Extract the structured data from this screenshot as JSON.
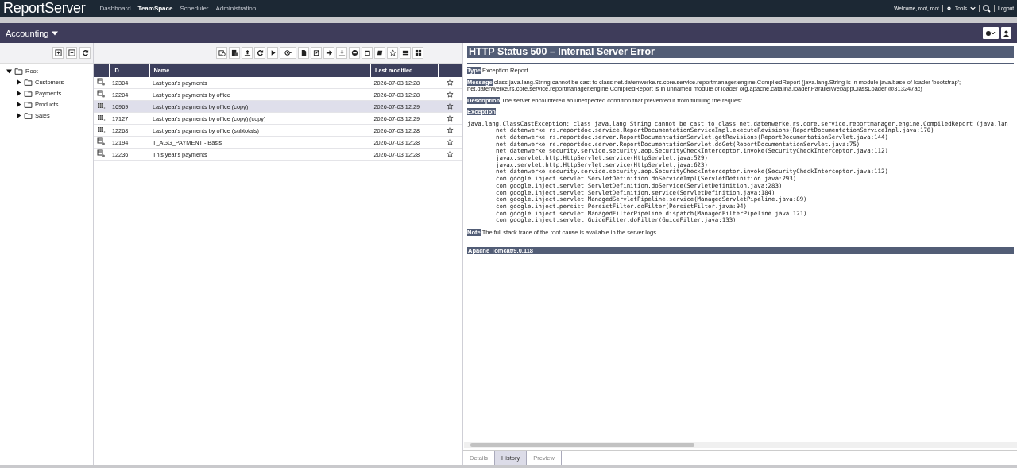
{
  "header": {
    "logo": "ReportServer",
    "nav": [
      {
        "label": "Dashboard",
        "selected": false
      },
      {
        "label": "TeamSpace",
        "selected": true
      },
      {
        "label": "Scheduler",
        "selected": false
      },
      {
        "label": "Administration",
        "selected": false
      }
    ],
    "welcome": "Welcome, root, root",
    "tools": "Tools",
    "logout": "Logout"
  },
  "teamspace": {
    "title": "Accounting"
  },
  "tree": [
    {
      "label": "Root",
      "expanded": true,
      "children": [
        {
          "label": "Customers",
          "expanded": false
        },
        {
          "label": "Payments",
          "expanded": false
        },
        {
          "label": "Products",
          "expanded": false
        },
        {
          "label": "Sales",
          "expanded": false
        }
      ]
    }
  ],
  "table": {
    "columns": [
      "ID",
      "Name",
      "Last modified"
    ],
    "rows": [
      {
        "kind": "report",
        "id": "12304",
        "name": "Last year's payments",
        "modified": "2026-07-03 12:28",
        "selected": false,
        "starred": false
      },
      {
        "kind": "report",
        "id": "12204",
        "name": "Last year's payments by office",
        "modified": "2026-07-03 12:28",
        "selected": false,
        "starred": false
      },
      {
        "kind": "grid",
        "id": "16969",
        "name": "Last year's payments by office (copy)",
        "modified": "2026-07-03 12:29",
        "selected": true,
        "starred": false
      },
      {
        "kind": "grid",
        "id": "17127",
        "name": "Last year's payments by office (copy) (copy)",
        "modified": "2026-07-03 12:29",
        "selected": false,
        "starred": false
      },
      {
        "kind": "grid",
        "id": "12268",
        "name": "Last year's payments by office (subtotals)",
        "modified": "2026-07-03 12:28",
        "selected": false,
        "starred": false
      },
      {
        "kind": "report",
        "id": "12194",
        "name": "T_AGG_PAYMENT - Basis",
        "modified": "2026-07-03 12:28",
        "selected": false,
        "starred": false
      },
      {
        "kind": "report",
        "id": "12236",
        "name": "This year's payments",
        "modified": "2026-07-03 12:28",
        "selected": false,
        "starred": false
      }
    ]
  },
  "error": {
    "title": "HTTP Status 500 – Internal Server Error",
    "fields": [
      {
        "label": "Type",
        "text": "Exception Report"
      },
      {
        "label": "Message",
        "text": "class java.lang.String cannot be cast to class net.datenwerke.rs.core.service.reportmanager.engine.CompiledReport (java.lang.String is in module java.base of loader 'bootstrap'; net.datenwerke.rs.core.service.reportmanager.engine.CompiledReport is in unnamed module of loader org.apache.catalina.loader.ParallelWebappClassLoader @313247ac)"
      },
      {
        "label": "Description",
        "text": "The server encountered an unexpected condition that prevented it from fulfilling the request."
      },
      {
        "label": "Exception"
      }
    ],
    "exception": "java.lang.ClassCastException: class java.lang.String cannot be cast to class net.datenwerke.rs.core.service.reportmanager.engine.CompiledReport (java.lan",
    "frames": [
      "net.datenwerke.rs.reportdoc.service.ReportDocumentationServiceImpl.executeRevisions(ReportDocumentationServiceImpl.java:170)",
      "net.datenwerke.rs.reportdoc.server.ReportDocumentationServlet.getRevisions(ReportDocumentationServlet.java:144)",
      "net.datenwerke.rs.reportdoc.server.ReportDocumentationServlet.doGet(ReportDocumentationServlet.java:75)",
      "net.datenwerke.security.service.security.aop.SecurityCheckInterceptor.invoke(SecurityCheckInterceptor.java:112)",
      "javax.servlet.http.HttpServlet.service(HttpServlet.java:529)",
      "javax.servlet.http.HttpServlet.service(HttpServlet.java:623)",
      "net.datenwerke.security.service.security.aop.SecurityCheckInterceptor.invoke(SecurityCheckInterceptor.java:112)",
      "com.google.inject.servlet.ServletDefinition.doServiceImpl(ServletDefinition.java:293)",
      "com.google.inject.servlet.ServletDefinition.doService(ServletDefinition.java:283)",
      "com.google.inject.servlet.ServletDefinition.service(ServletDefinition.java:184)",
      "com.google.inject.servlet.ManagedServletPipeline.service(ManagedServletPipeline.java:89)",
      "com.google.inject.persist.PersistFilter.doFilter(PersistFilter.java:94)",
      "com.google.inject.servlet.ManagedFilterPipeline.dispatch(ManagedFilterPipeline.java:121)",
      "com.google.inject.servlet.GuiceFilter.doFilter(GuiceFilter.java:133)"
    ],
    "note": {
      "label": "Note",
      "text": "The full stack trace of the root cause is available in the server logs."
    },
    "footer": "Apache Tomcat/9.0.118"
  },
  "tabs": [
    {
      "label": "Details",
      "selected": false
    },
    {
      "label": "History",
      "selected": true
    },
    {
      "label": "Preview",
      "selected": false
    }
  ]
}
